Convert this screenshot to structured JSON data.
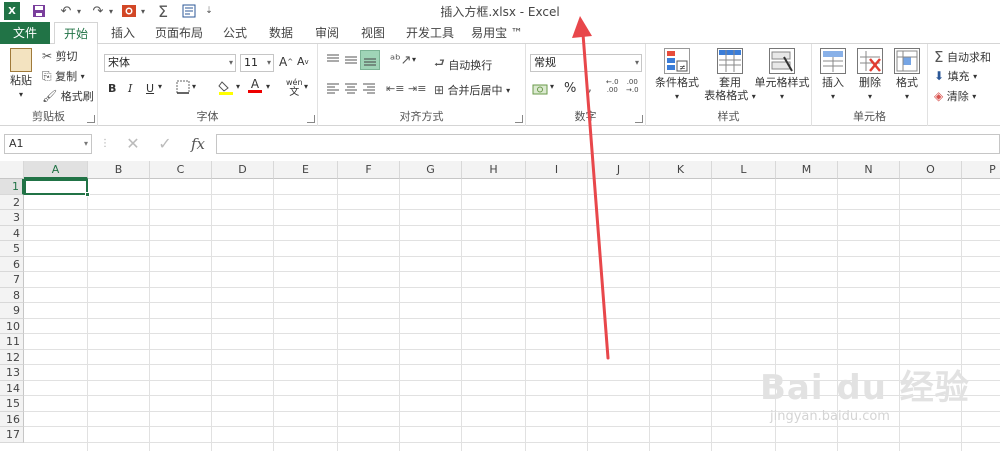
{
  "window": {
    "title": "插入方框.xlsx - Excel"
  },
  "quick_access": {
    "icons": [
      "excel-logo-icon",
      "save-icon",
      "undo-icon",
      "redo-icon",
      "presentation-icon",
      "sum-icon",
      "form-icon",
      "customize-icon"
    ]
  },
  "tabs": [
    "文件",
    "开始",
    "插入",
    "页面布局",
    "公式",
    "数据",
    "审阅",
    "视图",
    "开发工具",
    "易用宝 ™"
  ],
  "active_tab": "开始",
  "ribbon": {
    "clipboard": {
      "label": "剪贴板",
      "paste": "粘贴",
      "cut": "剪切",
      "copy": "复制",
      "format_painter": "格式刷"
    },
    "font": {
      "label": "字体",
      "name": "宋体",
      "size": "11",
      "bold": "B",
      "italic": "I",
      "underline": "U",
      "phonetic": "wén"
    },
    "alignment": {
      "label": "对齐方式",
      "wrap": "自动换行",
      "merge": "合并后居中"
    },
    "number": {
      "label": "数字",
      "format": "常规",
      "percent": "%",
      "inc_decimal": ".0 .00",
      "dec_decimal": ".00 .0"
    },
    "styles": {
      "label": "样式",
      "conditional": "条件格式",
      "table_line1": "套用",
      "table_line2": "表格格式",
      "cell_styles": "单元格样式"
    },
    "cells": {
      "label": "单元格",
      "insert": "插入",
      "delete": "删除",
      "format": "格式"
    },
    "editing": {
      "autosum": "自动求和",
      "fill": "填充",
      "clear": "清除"
    }
  },
  "formula_bar": {
    "name_box": "A1",
    "cancel": "✕",
    "enter": "✓",
    "fx": "fx",
    "value": ""
  },
  "columns": [
    "A",
    "B",
    "C",
    "D",
    "E",
    "F",
    "G",
    "H",
    "I",
    "J",
    "K",
    "L",
    "M",
    "N",
    "O",
    "P"
  ],
  "rows": [
    "1",
    "2",
    "3",
    "4",
    "5",
    "6",
    "7",
    "8",
    "9",
    "10",
    "11",
    "12",
    "13",
    "14",
    "15",
    "16",
    "17"
  ],
  "selected_cell": "A1",
  "watermark": {
    "brand": "Bai du 经验",
    "url": "jingyan.baidu.com"
  },
  "colors": {
    "accent": "#217346",
    "arrow": "#e8474b"
  }
}
